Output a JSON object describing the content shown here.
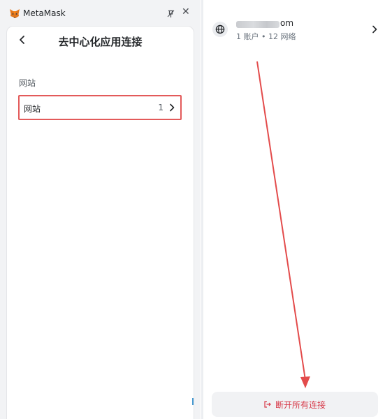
{
  "window": {
    "app_title": "MetaMask",
    "close_glyph": "✕",
    "icons": {
      "logo": "metamask-fox-icon",
      "pin": "pin-icon",
      "close": "close-icon"
    }
  },
  "connections_page": {
    "title": "去中心化应用连接",
    "section_label": "网站",
    "rows": [
      {
        "label": "网站",
        "count": "1"
      }
    ],
    "icons": {
      "back": "chevron-left-icon",
      "row": "chevron-right-icon"
    }
  },
  "site_detail": {
    "domain_suffix": "om",
    "subtitle": "1 账户 • 12 网络",
    "icons": {
      "site": "globe-icon",
      "open": "chevron-right-icon"
    },
    "disconnect_all_label": "断开所有连接",
    "disconnect_icon": "logout-icon"
  },
  "colors": {
    "highlight_box": "#e35a5a",
    "arrow": "#e34b4b",
    "danger_text": "#d73847",
    "panel_bg": "#f2f3f5"
  }
}
